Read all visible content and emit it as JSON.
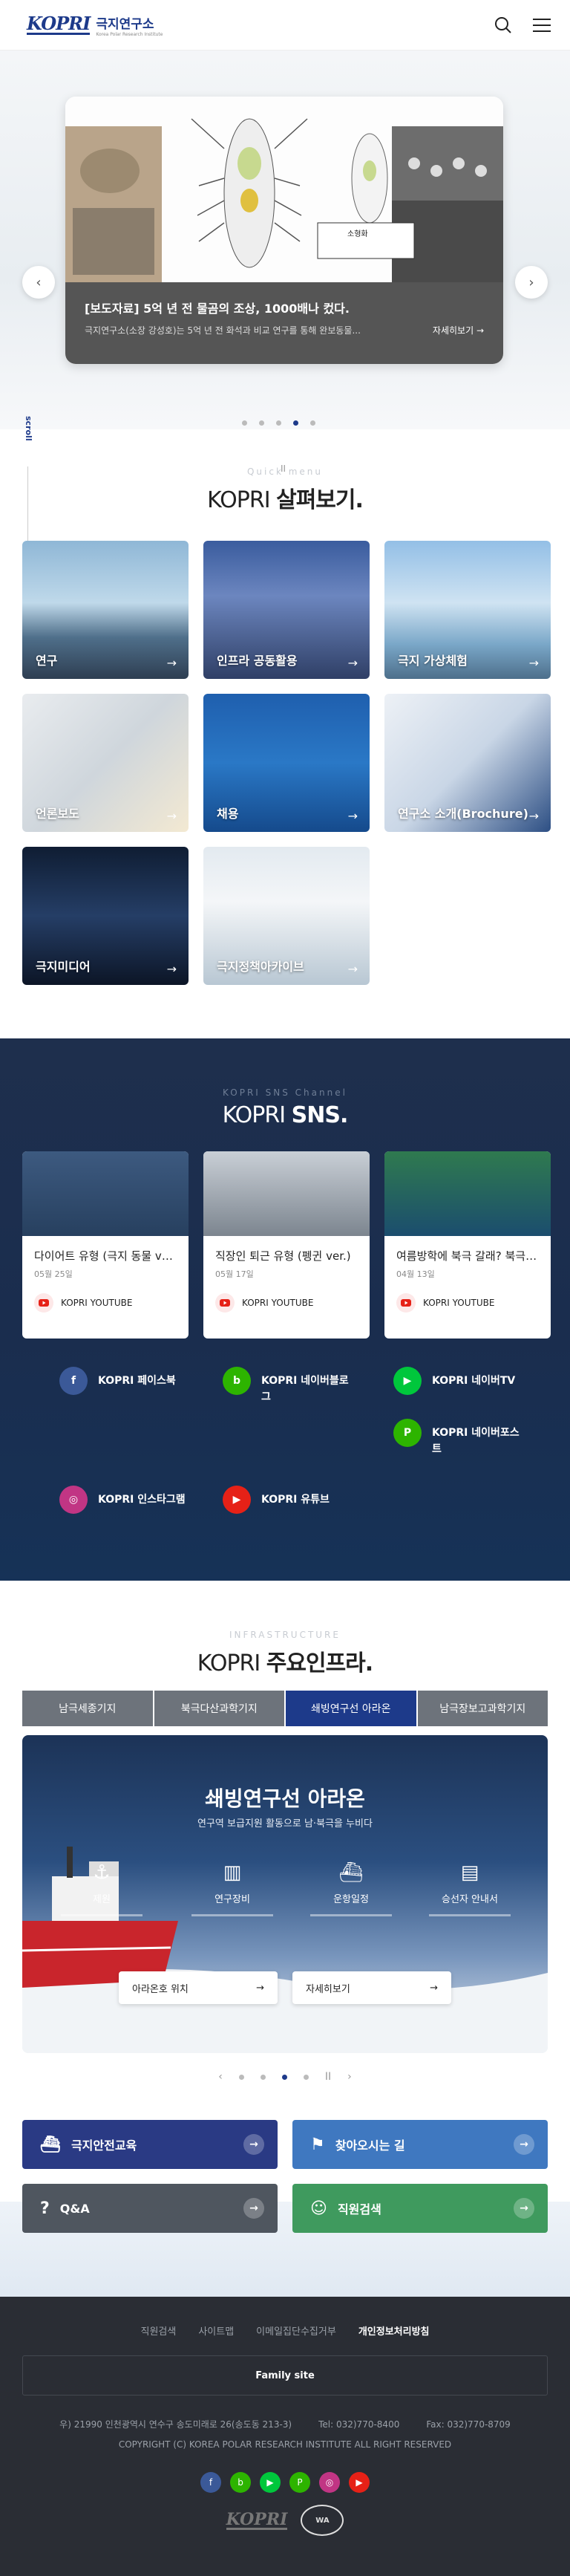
{
  "header": {
    "logo_mark": "KOPRI",
    "logo_ko": "극지연구소",
    "logo_en": "Korea Polar Research Institute"
  },
  "hero": {
    "caption_title": "[보도자료] 5억 년 전 물곰의 조상, 1000배나 컸다.",
    "caption_desc": "극지연구소(소장 강성호)는 5억 년 전 화석과 비교 연구를 통해 완보동물...",
    "more_label": "자세히보기",
    "scroll_label": "scroll",
    "slide_count": 5,
    "active_slide": 4,
    "pause_icon": "II",
    "figure_label": "소형화"
  },
  "quick": {
    "eyebrow": "Quick menu",
    "title_light": "KOPRI",
    "title_bold": "살펴보기.",
    "cards": [
      {
        "label": "연구",
        "bg": "linear-gradient(180deg,#8fb7d6 0%,#bfd9ea 45%,#4f6f8a 70%,#2e3e52 100%)"
      },
      {
        "label": "인프라 공동활용",
        "bg": "linear-gradient(180deg,#3a5c9e 0%,#6c86bf 40%,#2f3f66 100%)"
      },
      {
        "label": "극지 가상체험",
        "bg": "linear-gradient(180deg,#93bfe6 0%,#cfe3f2 45%,#7aa7c8 75%,#4d6f8b 100%)"
      },
      {
        "label": "언론보도",
        "bg": "linear-gradient(135deg,#e9ecef 0%,#cfd6dc 50%,#f3e9d2 100%)"
      },
      {
        "label": "채용",
        "bg": "linear-gradient(180deg,#1f5fae 0%,#2a78c6 50%,#154a8c 100%)"
      },
      {
        "label": "연구소 소개(Brochure)",
        "bg": "linear-gradient(135deg,#edf1f6 0%,#c9d6e6 50%,#2d4f84 100%)"
      },
      {
        "label": "극지미디어",
        "bg": "linear-gradient(180deg,#0f1d33 0%,#253e66 50%,#0c1526 100%)"
      },
      {
        "label": "극지정책아카이브",
        "bg": "linear-gradient(180deg,#e3eaf0 0%,#f4f6f8 40%,#b8c7d3 100%)"
      }
    ]
  },
  "sns": {
    "eyebrow": "KOPRI SNS Channel",
    "title_light": "KOPRI",
    "title_bold": "SNS.",
    "cards": [
      {
        "title": "다이어트 유형 (극지 동물 ver.)",
        "date": "05월 25일",
        "channel": "KOPRI YOUTUBE",
        "bg": "linear-gradient(180deg,#3d5a80 0%,#27405f 100%)"
      },
      {
        "title": "직장인 퇴근 유형 (펭귄 ver.)",
        "date": "05월 17일",
        "channel": "KOPRI YOUTUBE",
        "bg": "linear-gradient(180deg,#c9cfd6 0%,#7c858f 100%)"
      },
      {
        "title": "여름방학에 북극 갈래? 북극 연구",
        "date": "04월 13일",
        "channel": "KOPRI YOUTUBE",
        "bg": "linear-gradient(180deg,#2f7a4f 0%,#1b4d6e 100%)"
      }
    ],
    "links": [
      {
        "label": "KOPRI 페이스북",
        "color": "#3b5998",
        "glyph": "f"
      },
      {
        "label": "KOPRI 네이버블로그",
        "color": "#2db400",
        "glyph": "b"
      },
      {
        "label": "KOPRI 네이버TV",
        "color": "#00c73c",
        "glyph": "▶"
      },
      {
        "label": "KOPRI 네이버포스트",
        "color": "#2db400",
        "glyph": "P"
      },
      {
        "label": "KOPRI 인스타그램",
        "color": "#c13584",
        "glyph": "◎"
      },
      {
        "label": "KOPRI 유튜브",
        "color": "#e62117",
        "glyph": "▶"
      }
    ]
  },
  "infra": {
    "eyebrow": "INFRASTRUCTURE",
    "title_light": "KOPRI",
    "title_bold": "주요인프라.",
    "tabs": [
      "남극세종기지",
      "북극다산과학기지",
      "쇄빙연구선 아라온",
      "남극장보고과학기지"
    ],
    "active_tab": 2,
    "panel_title": "쇄빙연구선 아라온",
    "panel_sub": "연구역 보급지원 활동으로 남·북극을 누비다",
    "items": [
      "제원",
      "연구장비",
      "운항일정",
      "승선자 안내서"
    ],
    "btn_location": "아라온호 위치",
    "btn_more": "자세히보기",
    "slide_count": 4,
    "active_slide": 3,
    "prev": "‹",
    "next": "›",
    "pause": "II"
  },
  "bigbuttons": [
    {
      "label": "극지안전교육",
      "color": "#2a3a84",
      "icon": "ship-icon",
      "glyph": "⛴"
    },
    {
      "label": "찾아오시는 길",
      "color": "#3f78c0",
      "icon": "signpost-icon",
      "glyph": "⚑"
    },
    {
      "label": "Q&A",
      "color": "#4f565f",
      "icon": "qa-icon",
      "glyph": "?"
    },
    {
      "label": "직원검색",
      "color": "#3f9a5e",
      "icon": "person-search-icon",
      "glyph": "☺"
    }
  ],
  "footer": {
    "links": [
      "직원검색",
      "사이트맵",
      "이메일집단수집거부",
      "개인정보처리방침"
    ],
    "family_site": "Family site",
    "address": "우) 21990 인천광역시 연수구 송도미래로 26(송도동 213-3)",
    "tel": "Tel: 032)770-8400",
    "fax": "Fax: 032)770-8709",
    "copyright": "COPYRIGHT (C) KOREA POLAR RESEARCH INSTITUTE ALL RIGHT RESERVED",
    "sns": [
      {
        "color": "#3b5998",
        "glyph": "f"
      },
      {
        "color": "#2db400",
        "glyph": "b"
      },
      {
        "color": "#00c73c",
        "glyph": "▶"
      },
      {
        "color": "#2db400",
        "glyph": "P"
      },
      {
        "color": "#c13584",
        "glyph": "◎"
      },
      {
        "color": "#e62117",
        "glyph": "▶"
      }
    ],
    "logo1": "KOPRI",
    "logo2": "WA"
  }
}
